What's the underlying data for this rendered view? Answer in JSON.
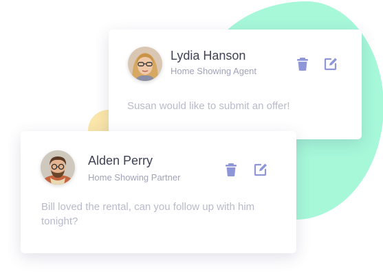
{
  "colors": {
    "accent_icon": "#8f96d8",
    "blob_green": "#a6f8d9",
    "blob_yellow": "#fbe7a9",
    "name_text": "#3f4156",
    "role_text": "#a0a3b8",
    "message_text": "#b8bacb"
  },
  "cards": [
    {
      "name": "Lydia Hanson",
      "role": "Home Showing Agent",
      "message": "Susan would like to submit an offer!",
      "icons": [
        "trash-icon",
        "edit-icon"
      ]
    },
    {
      "name": "Alden Perry",
      "role": "Home Showing Partner",
      "message": "Bill loved the rental, can you follow up with him tonight?",
      "icons": [
        "trash-icon",
        "edit-icon"
      ]
    }
  ]
}
